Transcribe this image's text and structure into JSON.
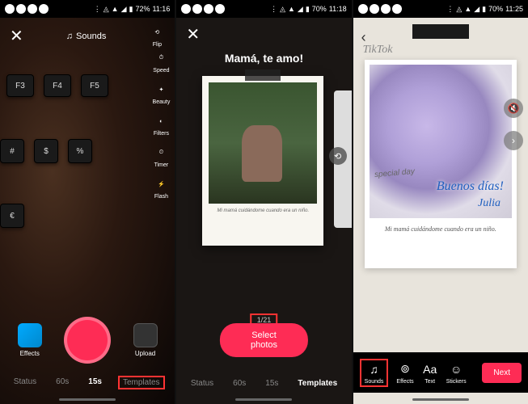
{
  "status": {
    "battery1": "72%",
    "time1": "11:16",
    "battery2": "70%",
    "time2": "11:18",
    "battery3": "70%",
    "time3": "11:25"
  },
  "screen1": {
    "sounds_label": "Sounds",
    "tools": {
      "flip": "Flip",
      "speed": "Speed",
      "beauty": "Beauty",
      "filters": "Filters",
      "timer": "Timer",
      "flash": "Flash"
    },
    "effects_label": "Effects",
    "upload_label": "Upload",
    "modes": {
      "status": "Status",
      "sixty": "60s",
      "fifteen": "15s",
      "templates": "Templates"
    },
    "keys": {
      "f3": "F3",
      "f4": "F4",
      "f5": "F5",
      "hash": "#",
      "dollar": "$",
      "percent": "%",
      "euro": "€"
    }
  },
  "screen2": {
    "title": "Mamá, te amo!",
    "caption": "Mi mamá cuidándome cuando era un niño.",
    "counter": "1/21",
    "select_label": "Select photos",
    "modes": {
      "status": "Status",
      "sixty": "60s",
      "fifteen": "15s",
      "templates": "Templates"
    }
  },
  "screen3": {
    "watermark": "TikTok",
    "overlay1": "Buenos días!",
    "overlay2": "Julia",
    "label": "special day",
    "caption": "Mi mamá cuidándome cuando era un niño.",
    "tools": {
      "sounds": "Sounds",
      "effects": "Effects",
      "text": "Text",
      "stickers": "Stickers"
    },
    "next_label": "Next"
  }
}
